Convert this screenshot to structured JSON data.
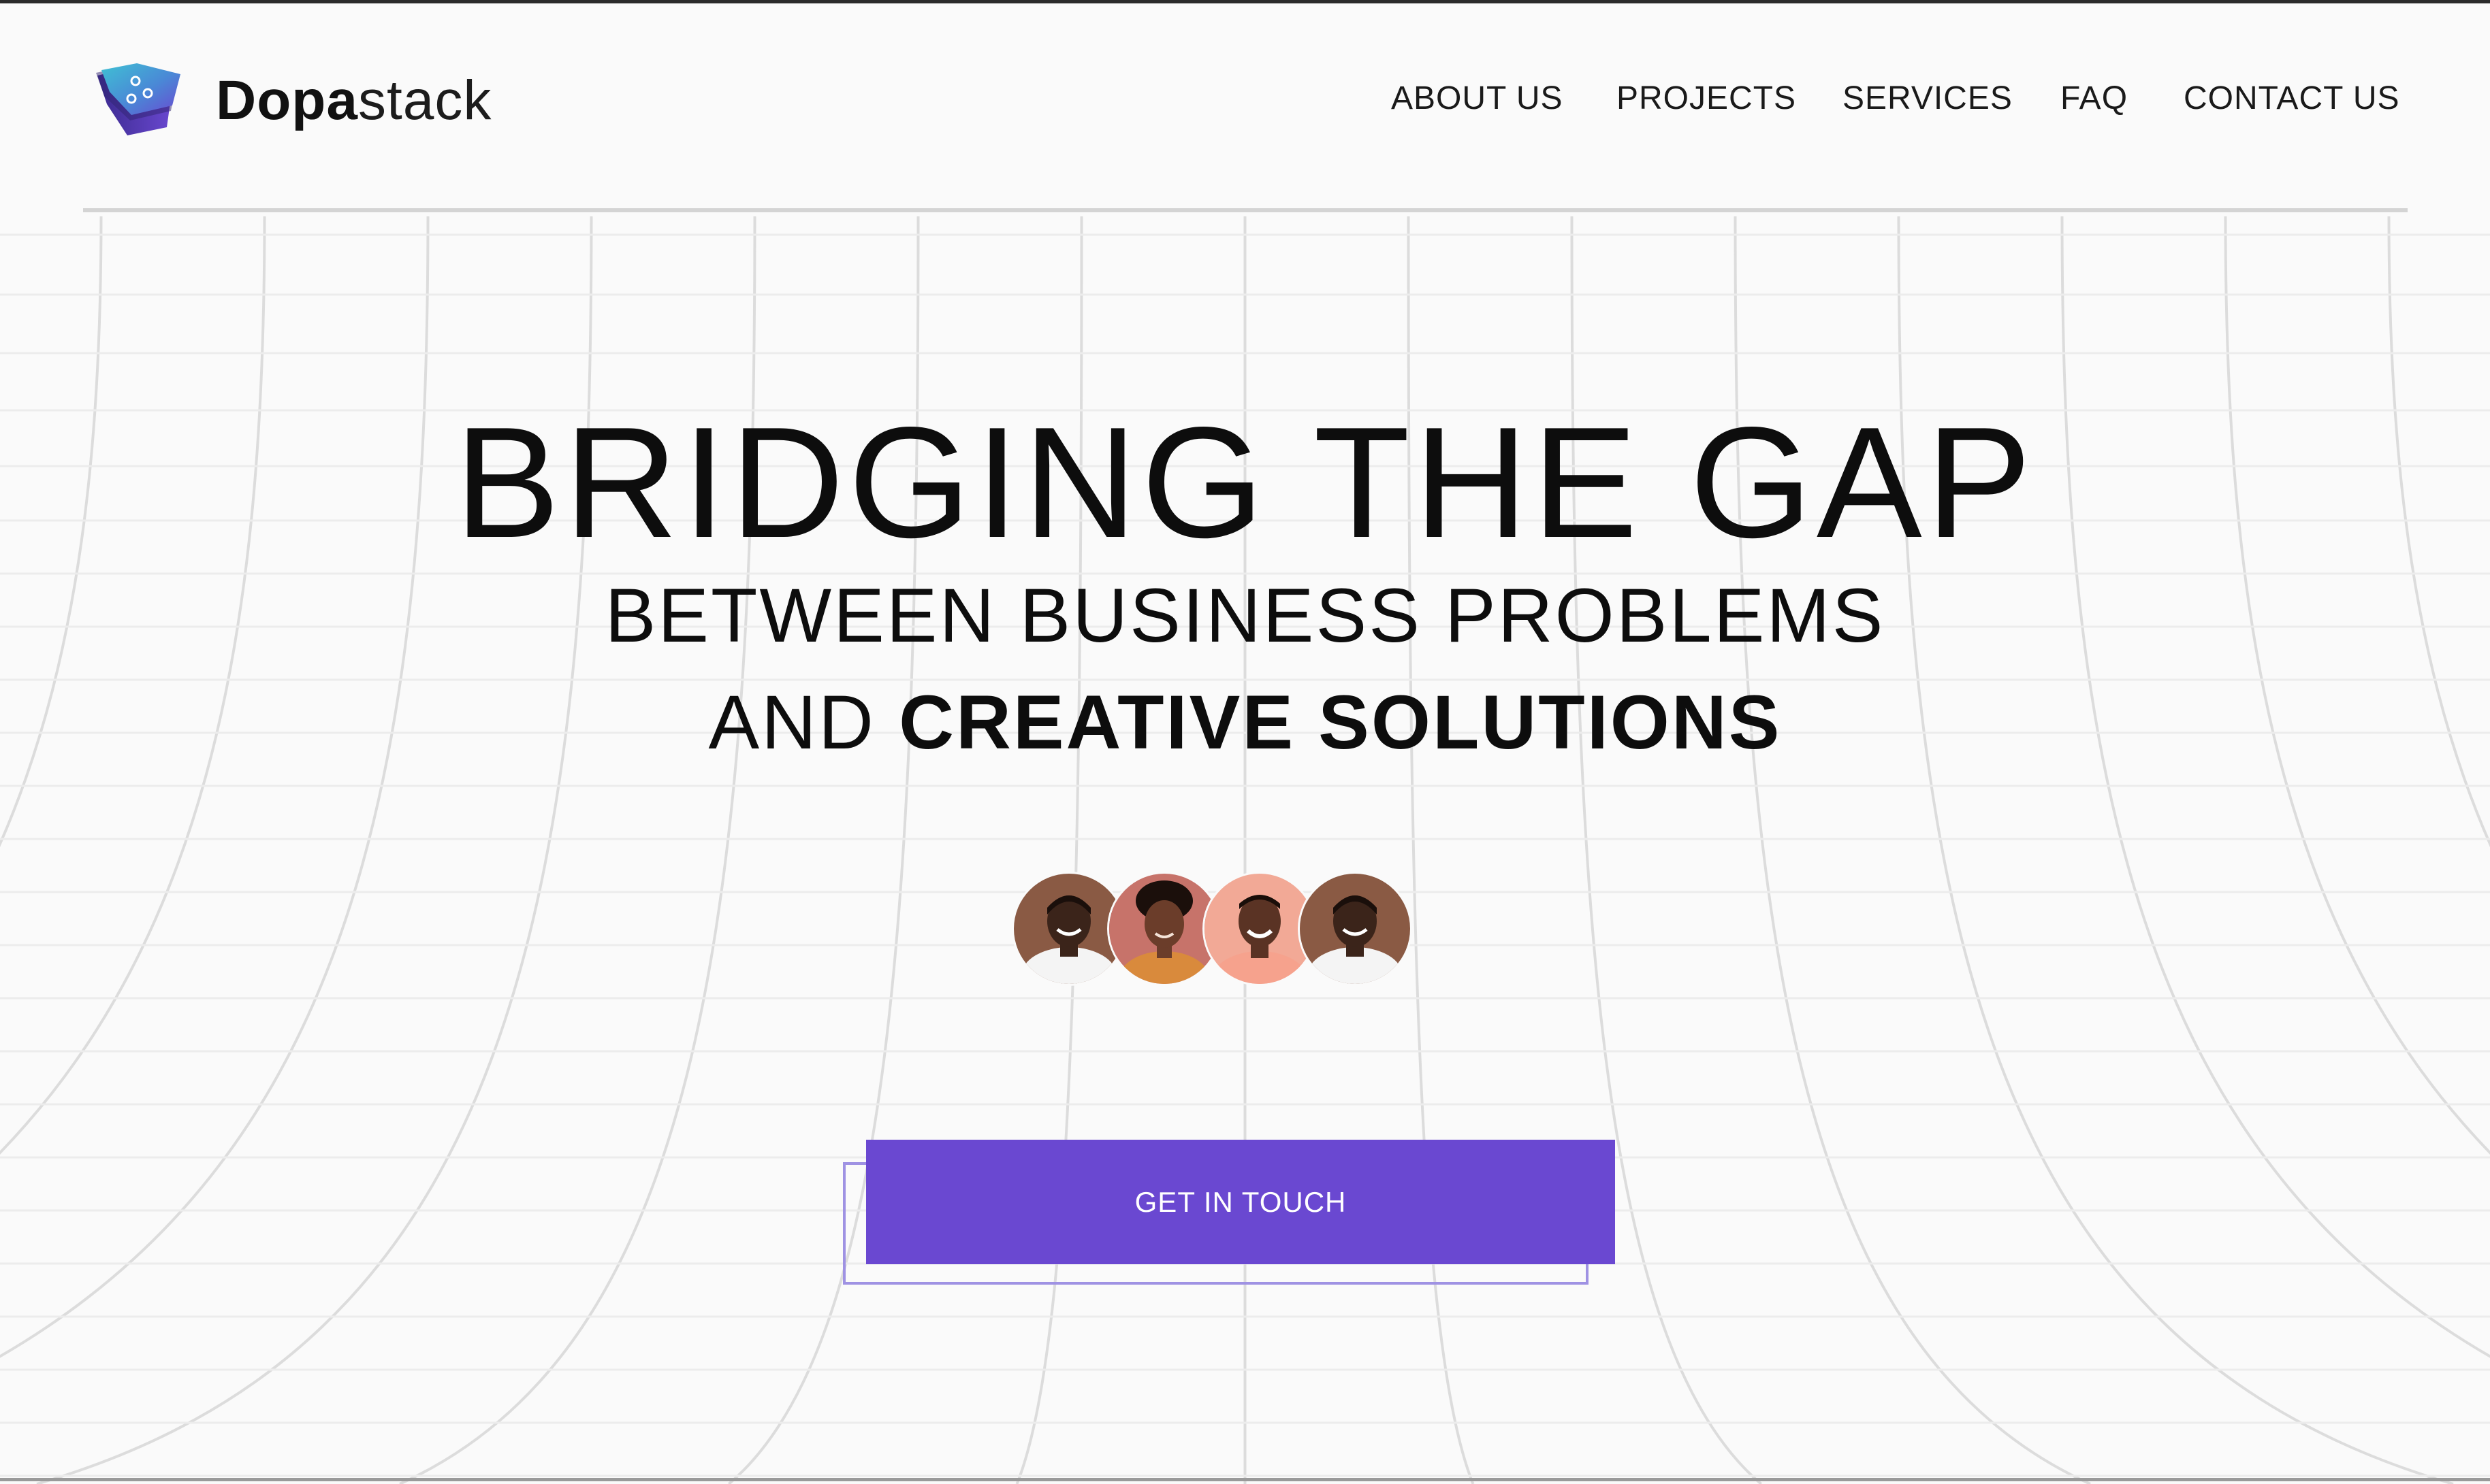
{
  "brand": {
    "name_strong": "Dopa",
    "name_light": "stack",
    "logo_icon": "layered-cube-icon",
    "colors": {
      "accent_purple": "#6a48d1",
      "logo_teal": "#2fb5c9",
      "logo_violet": "#5a3fc4"
    }
  },
  "nav": {
    "items": [
      {
        "label": "ABOUT US"
      },
      {
        "label": "PROJECTS"
      },
      {
        "label": "SERVICES"
      },
      {
        "label": "FAQ"
      },
      {
        "label": "CONTACT US"
      }
    ]
  },
  "hero": {
    "title": "BRIDGING THE GAP",
    "subtitle_line1": "BETWEEN BUSINESS PROBLEMS",
    "subtitle_line2_light": "AND ",
    "subtitle_line2_bold": "CREATIVE SOLUTIONS"
  },
  "team": {
    "avatars": [
      {
        "name": "team-member-1",
        "bg": "#8a5a44",
        "skin": "#3b241a",
        "shirt": "#f4f4f4",
        "hair": "#1a0f0b"
      },
      {
        "name": "team-member-2",
        "bg": "#c7736a",
        "skin": "#6b3d2a",
        "shirt": "#d98a3c",
        "hair": "#1b0f0b"
      },
      {
        "name": "team-member-3",
        "bg": "#f2a996",
        "skin": "#5a3324",
        "shirt": "#f6a28d",
        "hair": "#1a0e09"
      },
      {
        "name": "team-member-4",
        "bg": "#8a5a44",
        "skin": "#3b241a",
        "shirt": "#f4f4f4",
        "hair": "#1a0f0b"
      }
    ]
  },
  "cta": {
    "label": "GET IN TOUCH"
  }
}
